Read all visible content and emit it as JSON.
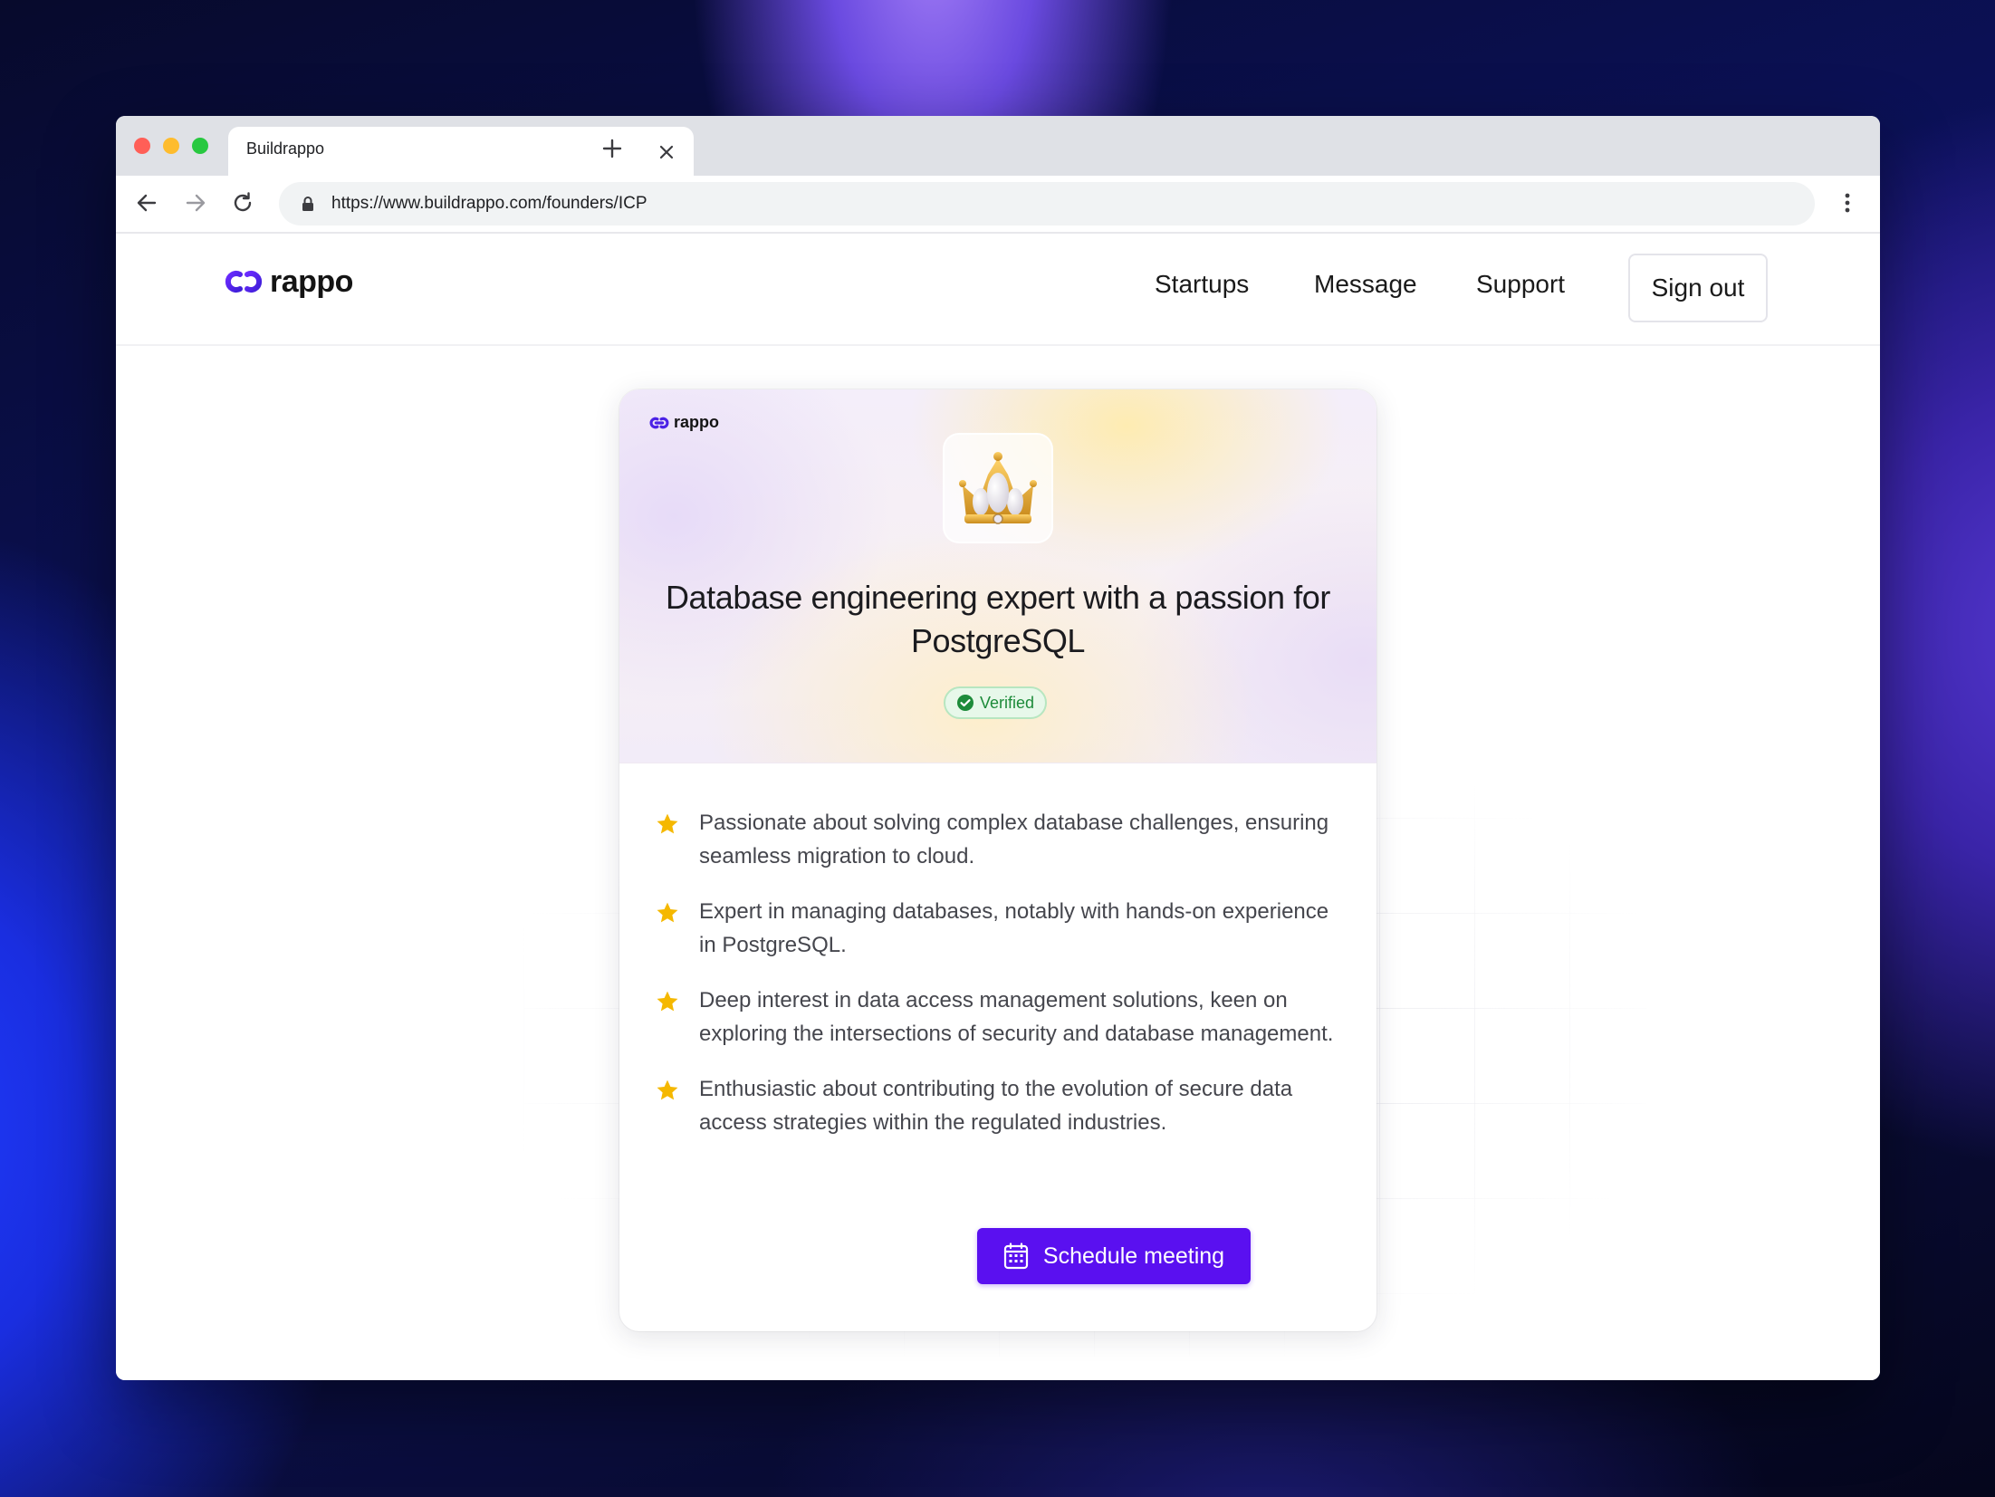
{
  "browser": {
    "tab_title": "Buildrappo",
    "url": "https://www.buildrappo.com/founders/ICP",
    "icons": [
      "back-icon",
      "forward-icon",
      "reload-icon",
      "lock-icon",
      "close-icon",
      "plus-icon",
      "kebab-menu-icon"
    ]
  },
  "header": {
    "logo_text": "rappo",
    "nav": [
      "Startups",
      "Message",
      "Support"
    ],
    "signout_label": "Sign out"
  },
  "card": {
    "logo_text": "rappo",
    "image": "crown-icon",
    "title": "Database engineering expert with a passion for PostgreSQL",
    "badge": "Verified",
    "points": [
      "Passionate about solving complex database challenges, ensuring seamless migration to cloud.",
      "Expert in managing databases, notably with hands-on experience in PostgreSQL.",
      "Deep interest in data access management solutions, keen on exploring the intersections of security and database management.",
      "Enthusiastic about contributing to the evolution of secure data access strategies within the regulated industries."
    ],
    "cta_label": "Schedule meeting"
  },
  "colors": {
    "accent": "#5a10f0",
    "star": "#f5b800",
    "verified": "#1d8b3a"
  }
}
